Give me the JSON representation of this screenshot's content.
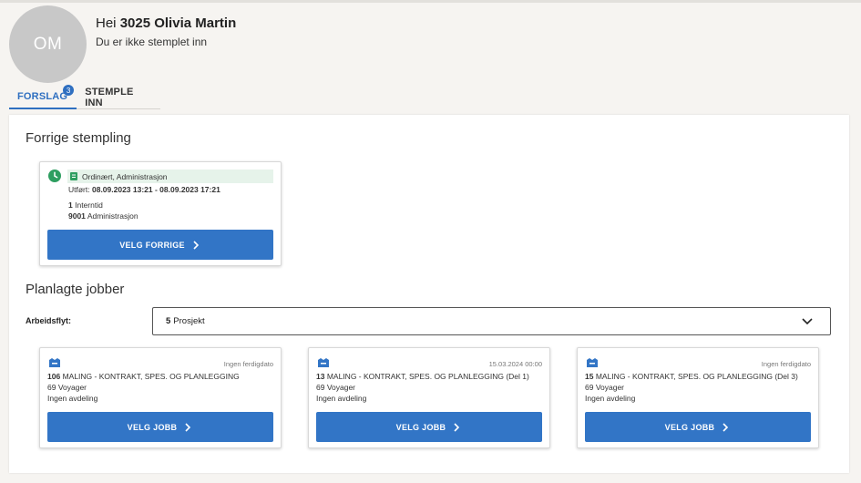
{
  "header": {
    "avatar_initials": "OM",
    "greeting_prefix": "Hei",
    "user_name": "3025 Olivia Martin",
    "status": "Du er ikke stemplet inn"
  },
  "tabs": [
    {
      "label": "FORSLAG",
      "badge": "3",
      "active": true
    },
    {
      "label": "STEMPLE INN",
      "active": false
    }
  ],
  "previous": {
    "title": "Forrige stempling",
    "type": "Ordinært, Administrasjon",
    "performed_label": "Utført:",
    "performed_value": "08.09.2023 13:21 - 08.09.2023 17:21",
    "line1_num": "1",
    "line1_text": "Interntid",
    "line2_num": "9001",
    "line2_text": "Administrasjon",
    "button": "VELG FORRIGE"
  },
  "planned": {
    "title": "Planlagte jobber",
    "workflow_label": "Arbeidsflyt:",
    "workflow_num": "5",
    "workflow_value": "Prosjekt",
    "jobs": [
      {
        "date": "Ingen ferdigdato",
        "num": "106",
        "name": "MALING - KONTRAKT, SPES. OG PLANLEGGING",
        "vessel": "69 Voyager",
        "dept": "Ingen avdeling",
        "button": "VELG JOBB"
      },
      {
        "date": "15.03.2024 00:00",
        "num": "13",
        "name": "MALING - KONTRAKT, SPES. OG PLANLEGGING (Del 1)",
        "vessel": "69 Voyager",
        "dept": "Ingen avdeling",
        "button": "VELG JOBB"
      },
      {
        "date": "Ingen ferdigdato",
        "num": "15",
        "name": "MALING - KONTRAKT, SPES. OG PLANLEGGING (Del 3)",
        "vessel": "69 Voyager",
        "dept": "Ingen avdeling",
        "button": "VELG JOBB"
      }
    ]
  },
  "colors": {
    "accent": "#3275c6",
    "clock": "#2e9e60",
    "type_bg": "#e6f3ea"
  }
}
